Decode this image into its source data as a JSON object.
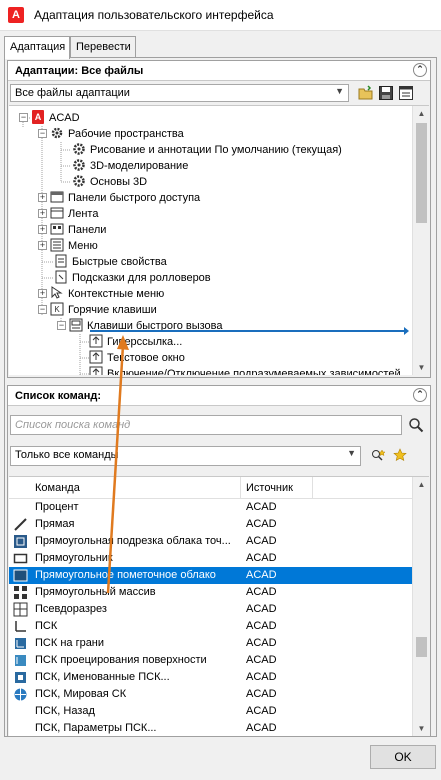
{
  "window": {
    "title": "Адаптация пользовательского интерфейса",
    "app_icon_letter": "A"
  },
  "tabs": [
    {
      "label": "Адаптация",
      "active": true
    },
    {
      "label": "Перевести",
      "active": false
    }
  ],
  "adaptations": {
    "header": "Адаптации: Все файлы",
    "collapse_glyph": "⌃",
    "filter": {
      "value": "Все файлы адаптации",
      "options_visible": [
        "Все файлы адаптации"
      ]
    },
    "toolbar_icons": [
      "open-file-icon",
      "save-icon",
      "properties-icon"
    ],
    "tree": [
      {
        "label": "ACAD",
        "icon": "acad-file-icon",
        "expander": "−"
      },
      {
        "label": "Рабочие пространства",
        "icon": "workspaces-gear-icon",
        "expander": "−"
      },
      {
        "label": "Рисование и аннотации По умолчанию (текущая)",
        "icon": "gear-icon",
        "expander": ""
      },
      {
        "label": "3D-моделирование",
        "icon": "gear-icon",
        "expander": ""
      },
      {
        "label": "Основы 3D",
        "icon": "gear-icon",
        "expander": ""
      },
      {
        "label": "Панели быстрого доступа",
        "icon": "quick-access-toolbar-icon",
        "expander": "+"
      },
      {
        "label": "Лента",
        "icon": "ribbon-icon",
        "expander": "+"
      },
      {
        "label": "Панели",
        "icon": "toolbars-icon",
        "expander": "+"
      },
      {
        "label": "Меню",
        "icon": "menu-icon",
        "expander": "+"
      },
      {
        "label": "Быстрые свойства",
        "icon": "quick-properties-icon",
        "expander": ""
      },
      {
        "label": "Подсказки для ролловеров",
        "icon": "rollover-tooltips-icon",
        "expander": ""
      },
      {
        "label": "Контекстные меню",
        "icon": "shortcut-menus-icon",
        "expander": "+"
      },
      {
        "label": "Горячие клавиши",
        "icon": "keyboard-shortcuts-icon",
        "expander": "−"
      },
      {
        "label": "Клавиши быстрого вызова",
        "icon": "shortcut-keys-icon",
        "expander": "−"
      },
      {
        "label": "Гиперссылка...",
        "icon": "hyperlink-key-icon",
        "expander": ""
      },
      {
        "label": "Текстовое окно",
        "icon": "text-window-key-icon",
        "expander": ""
      },
      {
        "label": "Включение/Отключение подразумеваемых зависимостей",
        "icon": "toggle-constraints-key-icon",
        "expander": ""
      }
    ]
  },
  "commands": {
    "header": "Список команд:",
    "collapse_glyph": "⌃",
    "search": {
      "placeholder": "Список поиска команд",
      "value": ""
    },
    "filter": {
      "value": "Только все команды"
    },
    "columns": [
      "Команда",
      "Источник"
    ],
    "rows": [
      {
        "name": "Процент",
        "source": "ACAD",
        "icon": "none",
        "selected": false
      },
      {
        "name": "Прямая",
        "source": "ACAD",
        "icon": "line-icon",
        "selected": false
      },
      {
        "name": "Прямоугольная подрезка облака точ...",
        "source": "ACAD",
        "icon": "pointcloud-clip-icon",
        "selected": false
      },
      {
        "name": "Прямоугольник",
        "source": "ACAD",
        "icon": "rectangle-icon",
        "selected": false
      },
      {
        "name": "Прямоугольное пометочное облако",
        "source": "ACAD",
        "icon": "revcloud-rect-icon",
        "selected": true
      },
      {
        "name": "Прямоугольный массив",
        "source": "ACAD",
        "icon": "array-rect-icon",
        "selected": false
      },
      {
        "name": "Псевдоразрез",
        "source": "ACAD",
        "icon": "section-icon",
        "selected": false
      },
      {
        "name": "ПСК",
        "source": "ACAD",
        "icon": "ucs-icon",
        "selected": false
      },
      {
        "name": "ПСК на грани",
        "source": "ACAD",
        "icon": "ucs-face-icon",
        "selected": false
      },
      {
        "name": "ПСК проецирования поверхности",
        "source": "ACAD",
        "icon": "ucs-project-icon",
        "selected": false
      },
      {
        "name": "ПСК, Именованные ПСК...",
        "source": "ACAD",
        "icon": "ucs-named-icon",
        "selected": false
      },
      {
        "name": "ПСК, Мировая СК",
        "source": "ACAD",
        "icon": "ucs-world-icon",
        "selected": false
      },
      {
        "name": "ПСК, Назад",
        "source": "ACAD",
        "icon": "none",
        "selected": false
      },
      {
        "name": "ПСК, Параметры ПСК...",
        "source": "ACAD",
        "icon": "none",
        "selected": false
      }
    ]
  },
  "buttons": {
    "ok": "OK"
  },
  "colors": {
    "selection": "#0078d7",
    "drag_line": "#1a6ebd",
    "drag_arrow": "#e07a1f",
    "acad_red": "#e22222"
  }
}
